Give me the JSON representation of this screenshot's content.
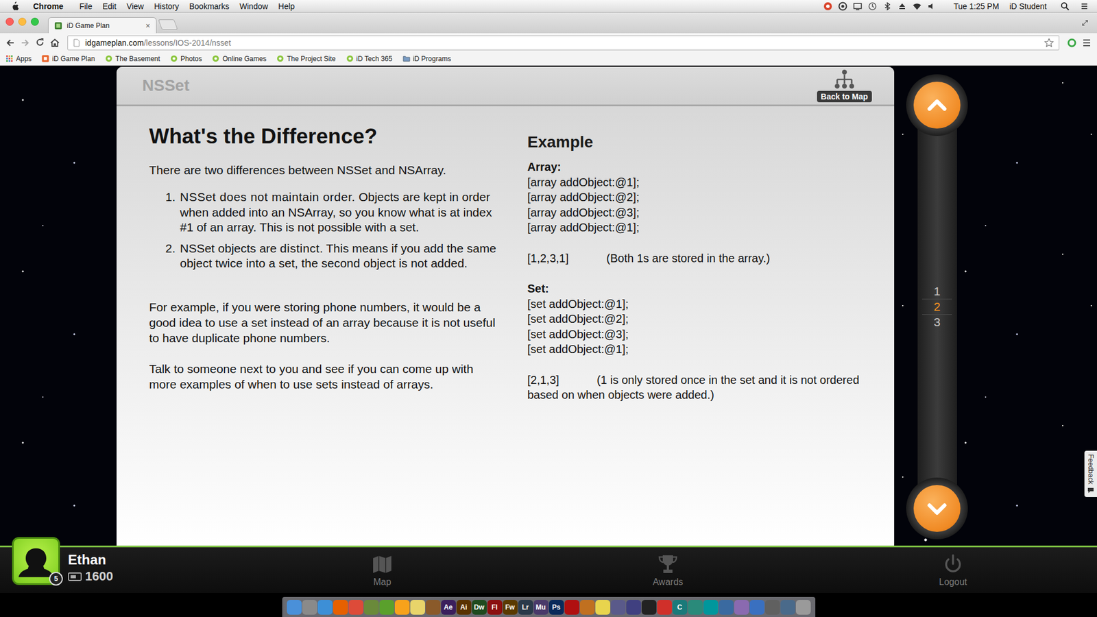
{
  "menubar": {
    "app": "Chrome",
    "menus": [
      "File",
      "Edit",
      "View",
      "History",
      "Bookmarks",
      "Window",
      "Help"
    ],
    "clock": "Tue 1:25 PM",
    "user": "iD Student"
  },
  "tabs": [
    {
      "title": "iD Game Plan",
      "close": "×",
      "selected": true
    }
  ],
  "address": {
    "host": "idgameplan.com",
    "path": "/lessons/IOS-2014/nsset"
  },
  "bookmarks": [
    {
      "label": "Apps",
      "kind": "apps"
    },
    {
      "label": "iD Game Plan",
      "kind": "idgp"
    },
    {
      "label": "The Basement",
      "kind": "site"
    },
    {
      "label": "Photos",
      "kind": "site"
    },
    {
      "label": "Online Games",
      "kind": "site"
    },
    {
      "label": "The Project Site",
      "kind": "site"
    },
    {
      "label": "iD Tech 365",
      "kind": "site"
    },
    {
      "label": "iD Programs",
      "kind": "folder"
    }
  ],
  "lesson": {
    "title": "NSSet",
    "back": "Back to Map",
    "heading": "What's the Difference?",
    "intro": "There are two differences between NSSet and NSArray.",
    "differences": [
      {
        "number": "1.",
        "parts": [
          {
            "text": "NSSet does not maintain order.",
            "em": true
          },
          {
            "text": " Objects are kept in order when added into an NSArray, so you know what is at index #1 of an array. This is not possible with a set.",
            "em": false
          }
        ]
      },
      {
        "number": "2.",
        "parts": [
          {
            "text": "NSSet objects are ",
            "em": false
          },
          {
            "text": "distinct",
            "em": true
          },
          {
            "text": ". This means if you add the same object twice into a set, the second object is not added.",
            "em": false
          }
        ]
      }
    ],
    "paragraphs": [
      "For example, if you were storing phone numbers, it would be a good idea to use a set instead of an array because it is not useful to have duplicate phone numbers.",
      "Talk to someone next to you and see if you can come up with more examples of when to use sets instead of arrays."
    ],
    "example": {
      "heading": "Example",
      "groups": [
        {
          "label": "Array:",
          "lines": [
            "[array addObject:@1];",
            "[array addObject:@2];",
            "[array addObject:@3];",
            "[array addObject:@1];"
          ],
          "result": "[1,2,3,1]",
          "note": "(Both 1s are stored in the array.)"
        },
        {
          "label": "Set:",
          "lines": [
            "[set addObject:@1];",
            "[set addObject:@2];",
            "[set addObject:@3];",
            "[set addObject:@1];"
          ],
          "result": "[2,1,3]",
          "note": "(1 is only stored once in the set and it is not ordered based on when objects were added.)"
        }
      ]
    }
  },
  "pager": {
    "pages": [
      {
        "label": "1",
        "selected": false
      },
      {
        "label": "2",
        "selected": true
      },
      {
        "label": "3",
        "selected": false
      }
    ]
  },
  "feedback": "Feedback",
  "player": {
    "name": "Ethan",
    "points": "1600",
    "level": "5"
  },
  "gamebar": [
    {
      "label": "Map",
      "kind": "map"
    },
    {
      "label": "Awards",
      "kind": "awards"
    },
    {
      "label": "Logout",
      "kind": "logout"
    }
  ],
  "dock": [
    {
      "color": "#4a90d9"
    },
    {
      "color": "#8a8a8a"
    },
    {
      "color": "#3d8fd6"
    },
    {
      "color": "#e66000"
    },
    {
      "color": "#dd4b39"
    },
    {
      "color": "#6a8a3a"
    },
    {
      "color": "#5aa02c"
    },
    {
      "color": "#f7a21b"
    },
    {
      "color": "#e8d46a"
    },
    {
      "color": "#8a5a2a"
    },
    {
      "label": "Ae",
      "color": "#3b1f5c"
    },
    {
      "label": "Ai",
      "color": "#5a3300"
    },
    {
      "label": "Dw",
      "color": "#1f4a1f"
    },
    {
      "label": "Fl",
      "color": "#8b1010"
    },
    {
      "label": "Fw",
      "color": "#5a3a00"
    },
    {
      "label": "Lr",
      "color": "#2a3a4a"
    },
    {
      "label": "Mu",
      "color": "#4a3a6a"
    },
    {
      "label": "Ps",
      "color": "#0a2a5a"
    },
    {
      "color": "#b01010"
    },
    {
      "color": "#c07020"
    },
    {
      "color": "#e8d44d"
    },
    {
      "color": "#5a5a8a"
    },
    {
      "color": "#404080"
    },
    {
      "color": "#222222"
    },
    {
      "color": "#d0302a"
    },
    {
      "label": "C",
      "color": "#1a7a7a"
    },
    {
      "color": "#2a8a7a"
    },
    {
      "color": "#00979c"
    },
    {
      "color": "#3a6aa0"
    },
    {
      "color": "#8a6ab0"
    },
    {
      "color": "#3a70c0"
    },
    {
      "color": "#606060"
    },
    {
      "color": "#4a6a8a"
    },
    {
      "color": "#9a9a9a"
    }
  ]
}
